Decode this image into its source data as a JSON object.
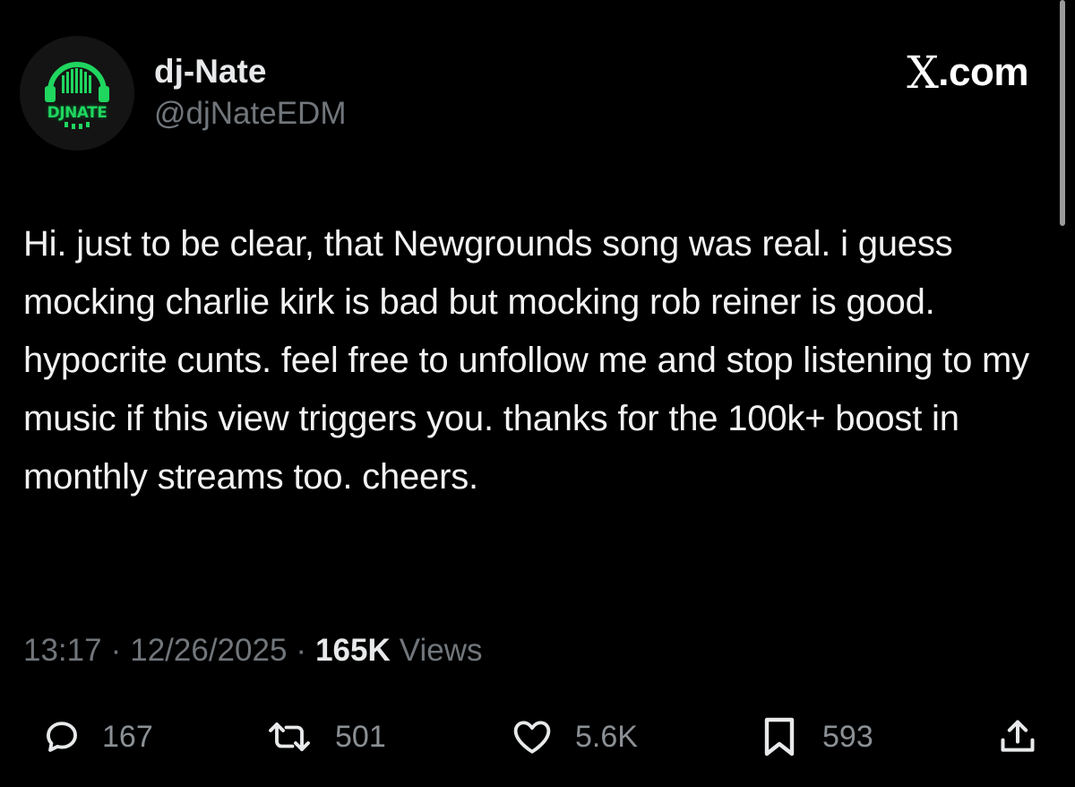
{
  "author": {
    "display_name": "dj-Nate",
    "handle": "@djNateEDM",
    "avatar_text": "DJNATE",
    "avatar_color": "#1fd65f"
  },
  "site": {
    "label": ".com",
    "logo_letter": "X"
  },
  "post": {
    "text": "Hi. just to be clear, that Newgrounds song was real. i guess mocking charlie kirk is bad but mocking rob reiner is good. hypocrite cunts. feel free to unfollow me and stop listening to my music if this view triggers you. thanks for the 100k+ boost in monthly streams too. cheers.",
    "time": "13:17",
    "date": "12/26/2025",
    "separator": "·",
    "views_count": "165K",
    "views_label": "Views"
  },
  "actions": {
    "reply": {
      "icon": "reply-icon",
      "count": "167"
    },
    "repost": {
      "icon": "repost-icon",
      "count": "501"
    },
    "like": {
      "icon": "heart-icon",
      "count": "5.6K"
    },
    "bookmark": {
      "icon": "bookmark-icon",
      "count": "593"
    },
    "share": {
      "icon": "share-icon"
    }
  },
  "colors": {
    "background": "#000000",
    "primary_text": "#e7e9ea",
    "secondary_text": "#71767b"
  }
}
